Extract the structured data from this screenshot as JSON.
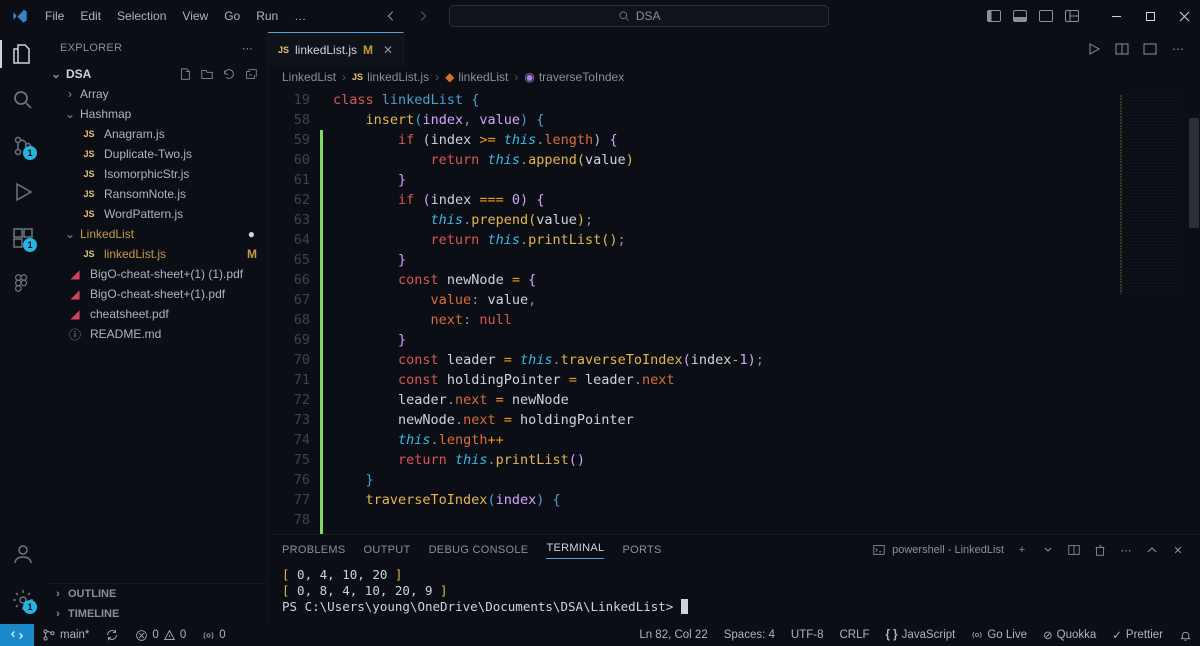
{
  "menu": [
    "File",
    "Edit",
    "Selection",
    "View",
    "Go",
    "Run",
    "…"
  ],
  "search_placeholder": "DSA",
  "explorer": {
    "title": "EXPLORER",
    "root": "DSA",
    "folders": [
      {
        "name": "Array",
        "open": false
      },
      {
        "name": "Hashmap",
        "open": true,
        "files": [
          "Anagram.js",
          "Duplicate-Two.js",
          "IsomorphicStr.js",
          "RansomNote.js",
          "WordPattern.js"
        ]
      },
      {
        "name": "LinkedList",
        "open": true,
        "modified": true,
        "files_mod": [
          {
            "name": "linkedList.js",
            "m": true
          }
        ]
      }
    ],
    "root_files": [
      {
        "name": "BigO-cheat-sheet+(1) (1).pdf",
        "type": "pdf"
      },
      {
        "name": "BigO-cheat-sheet+(1).pdf",
        "type": "pdf"
      },
      {
        "name": "cheatsheet.pdf",
        "type": "pdf"
      },
      {
        "name": "README.md",
        "type": "info"
      }
    ],
    "outline": "OUTLINE",
    "timeline": "TIMELINE"
  },
  "scm_badge": "1",
  "settings_badge": "1",
  "tab": {
    "name": "linkedList.js",
    "mod": "M"
  },
  "breadcrumb": [
    "LinkedList",
    "linkedList.js",
    "linkedList",
    "traverseToIndex"
  ],
  "line_start": 19,
  "panel_tabs": [
    "PROBLEMS",
    "OUTPUT",
    "DEBUG CONSOLE",
    "TERMINAL",
    "PORTS"
  ],
  "panel_active": "TERMINAL",
  "term_label": "powershell - LinkedList",
  "term_lines": [
    "[ 0, 4, 10, 20 ]",
    "[ 0, 8, 4, 10, 20, 9 ]",
    "PS C:\\Users\\young\\OneDrive\\Documents\\DSA\\LinkedList> "
  ],
  "status": {
    "branch": "main*",
    "sync": "",
    "errors": "0",
    "warnings": "0",
    "ports": "0",
    "pos": "Ln 82, Col 22",
    "spaces": "Spaces: 4",
    "enc": "UTF-8",
    "eol": "CRLF",
    "lang": "JavaScript",
    "golive": "Go Live",
    "quokka": "Quokka",
    "prettier": "Prettier"
  }
}
